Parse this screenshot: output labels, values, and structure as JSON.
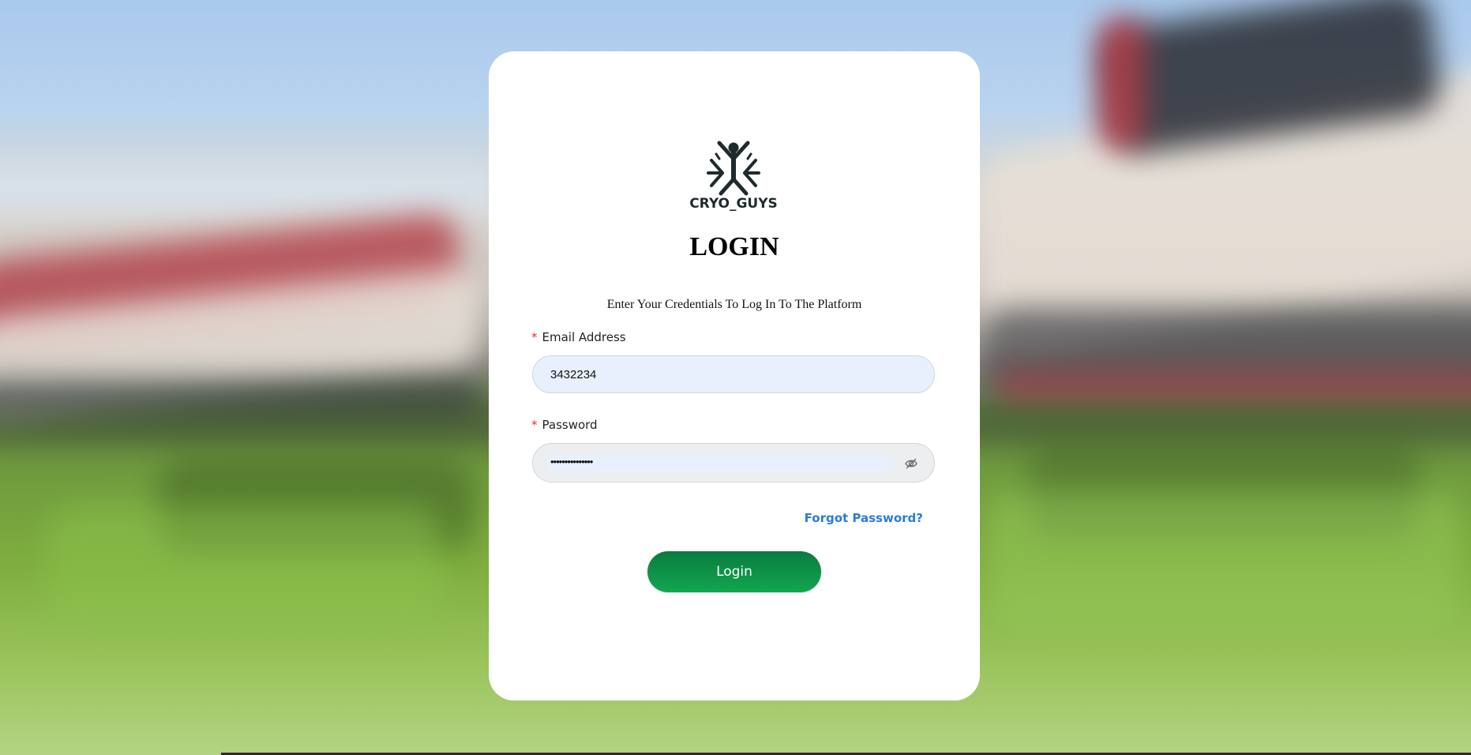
{
  "brand": {
    "name": "CRYO_GUYS",
    "logo_color": "#1f2a2c"
  },
  "login": {
    "title": "LOGIN",
    "subtitle": "Enter Your Credentials To Log In To The Platform",
    "email": {
      "label": "Email Address",
      "required_mark": "*",
      "value": "3432234"
    },
    "password": {
      "label": "Password",
      "required_mark": "*",
      "masked_value": "•••••••••••••••",
      "toggle_icon": "eye-off-icon"
    },
    "forgot_password": "Forgot Password?",
    "submit_label": "Login"
  },
  "colors": {
    "accent_green": "#0f8f47",
    "link_blue": "#2b7bd6",
    "required_red": "#e03131",
    "input_fill": "#e8f0fe"
  }
}
